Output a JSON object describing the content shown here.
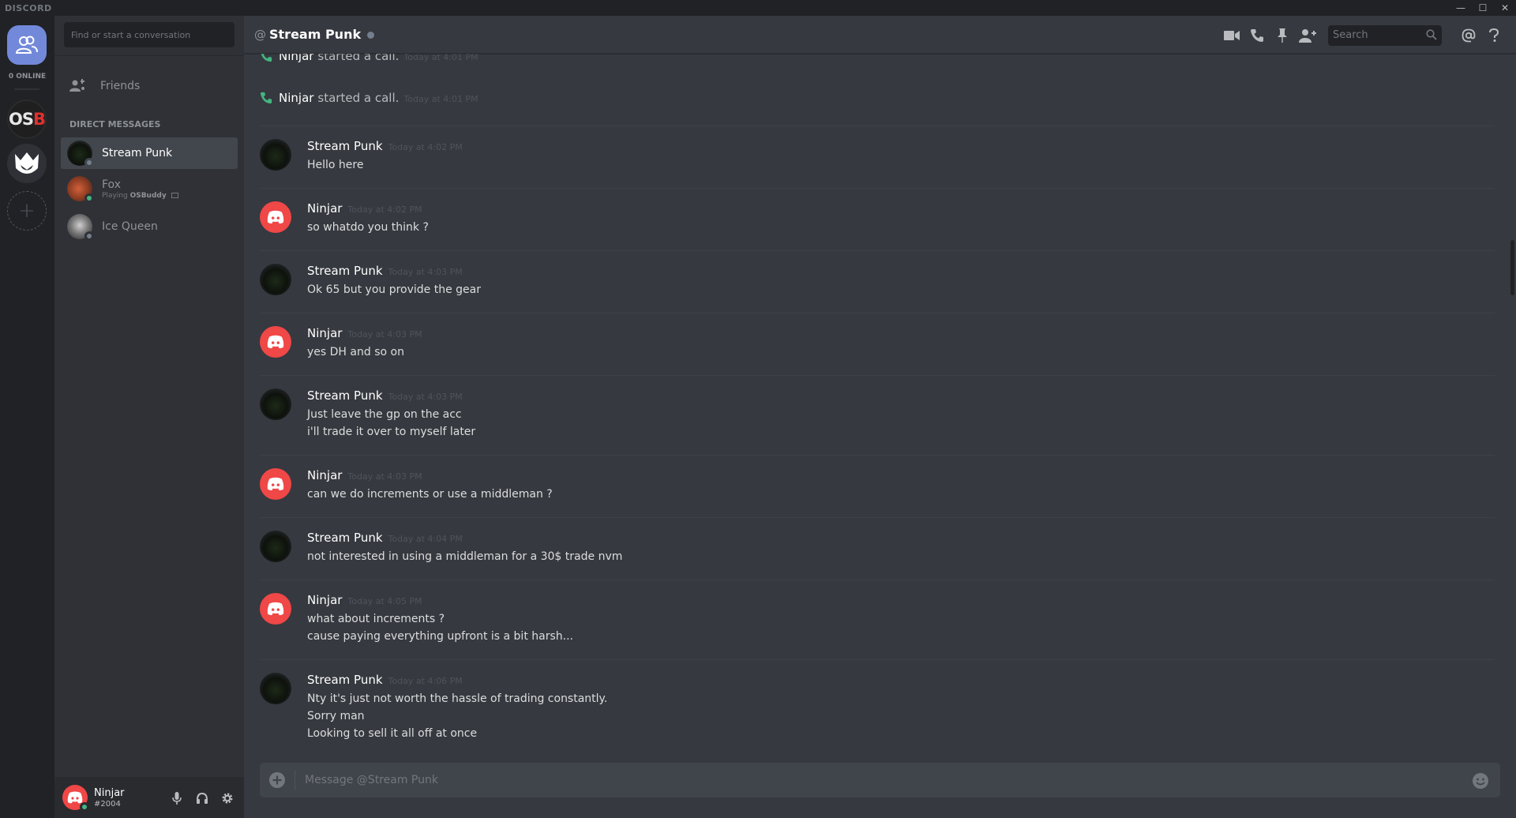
{
  "app": {
    "brand": "DISCORD"
  },
  "window_controls": {
    "minimize": "—",
    "maximize": "☐",
    "close": "✕"
  },
  "guilds": {
    "online_label": "0 ONLINE",
    "osb_label": "OS",
    "osb_label_b": "B",
    "add_label": "+"
  },
  "sidebar": {
    "search_placeholder": "Find or start a conversation",
    "friends_label": "Friends",
    "dm_header": "DIRECT MESSAGES",
    "dms": [
      {
        "name": "Stream Punk",
        "status_color": "#747f8d",
        "active": true
      },
      {
        "name": "Fox",
        "sub_prefix": "Playing ",
        "sub_game": "OSBuddy",
        "status_color": "#43b581"
      },
      {
        "name": "Ice Queen",
        "status_color": "#747f8d"
      }
    ]
  },
  "user": {
    "name": "Ninjar",
    "tag": "#2004",
    "status_color": "#43b581"
  },
  "header": {
    "at": "@",
    "title": "Stream Punk",
    "search_placeholder": "Search",
    "icons": [
      "video-call-icon",
      "voice-call-icon",
      "pin-icon",
      "add-friend-icon",
      "mention-icon",
      "help-icon"
    ]
  },
  "messages": {
    "system": [
      {
        "name": "Ninjar",
        "text": "started a call.",
        "timestamp": "Today at 4:01 PM"
      },
      {
        "name": "Ninjar",
        "text": "started a call.",
        "timestamp": "Today at 4:01 PM"
      }
    ],
    "groups": [
      {
        "author": "Stream Punk",
        "timestamp": "Today at 4:02 PM",
        "lines": [
          "Hello here"
        ]
      },
      {
        "author": "Ninjar",
        "timestamp": "Today at 4:02 PM",
        "lines": [
          "so whatdo you think ?"
        ]
      },
      {
        "author": "Stream Punk",
        "timestamp": "Today at 4:03 PM",
        "lines": [
          "Ok 65 but you provide the gear"
        ]
      },
      {
        "author": "Ninjar",
        "timestamp": "Today at 4:03 PM",
        "lines": [
          "yes DH and so on"
        ]
      },
      {
        "author": "Stream Punk",
        "timestamp": "Today at 4:03 PM",
        "lines": [
          "Just leave the gp on the acc",
          "i'll trade it over to myself later"
        ]
      },
      {
        "author": "Ninjar",
        "timestamp": "Today at 4:03 PM",
        "lines": [
          "can we do increments or use a middleman ?"
        ]
      },
      {
        "author": "Stream Punk",
        "timestamp": "Today at 4:04 PM",
        "lines": [
          "not interested in using a middleman for a 30$ trade nvm"
        ]
      },
      {
        "author": "Ninjar",
        "timestamp": "Today at 4:05 PM",
        "lines": [
          "what about increments ?",
          "cause paying everything upfront is a bit harsh..."
        ]
      },
      {
        "author": "Stream Punk",
        "timestamp": "Today at 4:06 PM",
        "lines": [
          "Nty it's just not worth the hassle of trading constantly.",
          "Sorry man",
          "Looking to sell it all off at once"
        ]
      }
    ]
  },
  "composer": {
    "placeholder": "Message @Stream Punk"
  },
  "colors": {
    "accent": "#7289da",
    "ninjar_avatar": "#f04747",
    "online": "#43b581",
    "offline": "#747f8d",
    "call_green": "#43b581"
  }
}
